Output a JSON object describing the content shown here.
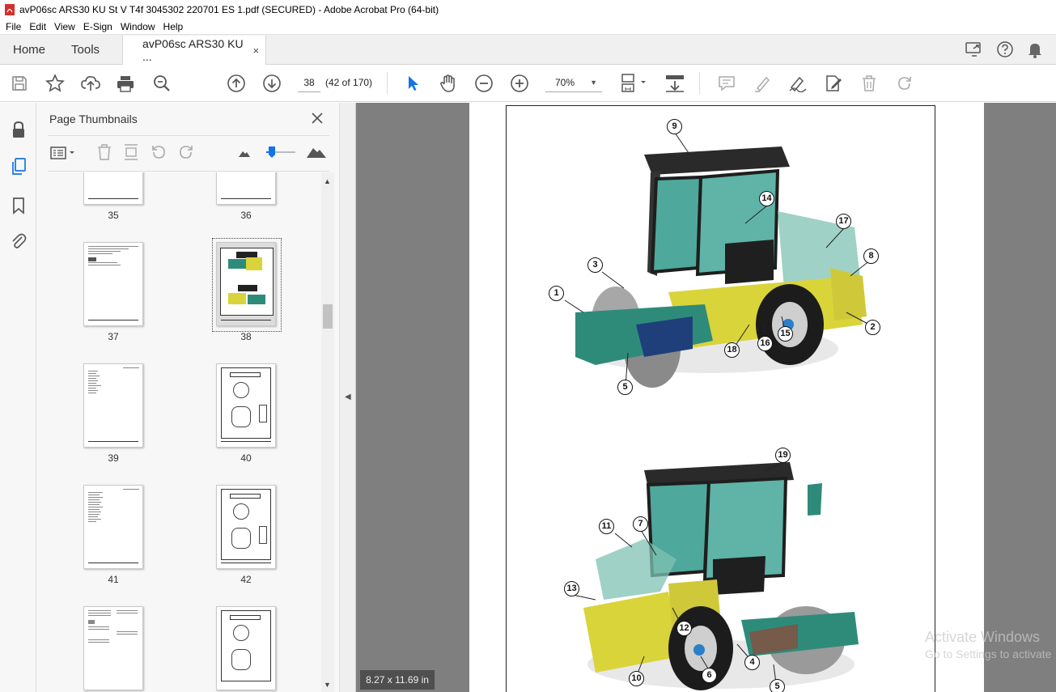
{
  "window": {
    "title": "avP06sc ARS30 KU St V T4f 3045302 220701 ES 1.pdf (SECURED) - Adobe Acrobat Pro (64-bit)"
  },
  "menu": [
    "File",
    "Edit",
    "View",
    "E-Sign",
    "Window",
    "Help"
  ],
  "tabs": {
    "home": "Home",
    "tools": "Tools",
    "document": "avP06sc ARS30 KU ...",
    "close": "×"
  },
  "toolbar": {
    "page_current": "38",
    "page_count": "(42 of 170)",
    "zoom": "70%"
  },
  "panel": {
    "title": "Page Thumbnails",
    "close": "×",
    "thumbnails": [
      "35",
      "36",
      "37",
      "38",
      "39",
      "40",
      "41",
      "42"
    ],
    "selected": "38"
  },
  "document": {
    "page_size": "8.27 x 11.69 in",
    "figure_top_callouts": [
      "9",
      "14",
      "17",
      "8",
      "3",
      "1",
      "2",
      "15",
      "16",
      "18",
      "5"
    ],
    "figure_bottom_callouts": [
      "19",
      "11",
      "7",
      "13",
      "12",
      "4",
      "10",
      "6",
      "5"
    ]
  },
  "watermark": {
    "line1": "Activate Windows",
    "line2": "Go to Settings to activate"
  },
  "colors": {
    "machine_yellow": "#d9d43a",
    "drum_teal": "#2e8b7a",
    "cab_black": "#222222",
    "glass": "#5fb3a7",
    "accent_blue": "#1473e6"
  }
}
